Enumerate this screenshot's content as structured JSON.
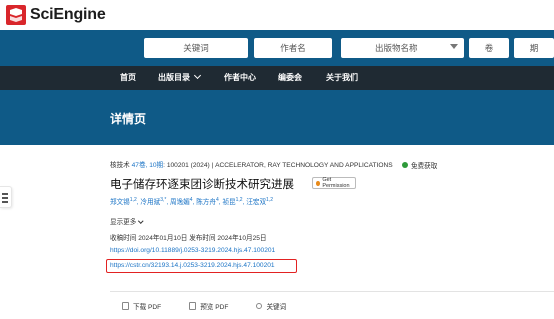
{
  "brand": {
    "name": "SciEngine"
  },
  "search": {
    "keyword": "关键词",
    "author": "作者名",
    "publication": "出版物名称",
    "volume": "卷",
    "issue": "期"
  },
  "nav": {
    "items": [
      {
        "label": "首页"
      },
      {
        "label": "出版目录"
      },
      {
        "label": "作者中心"
      },
      {
        "label": "编委会"
      },
      {
        "label": "关于我们"
      }
    ]
  },
  "banner": {
    "title": "详情页"
  },
  "article": {
    "meta_prefix": "核技术",
    "meta_volume": "47卷, 10期",
    "meta_rest": ": 100201 (2024) | ACCELERATOR, RAY TECHNOLOGY AND APPLICATIONS",
    "open_access": "免费获取",
    "title": "电子储存环逐束团诊断技术研究进展",
    "permission_button": "Get Permission",
    "authors": [
      {
        "name": "郑文锡",
        "sup": "1,2"
      },
      {
        "name": "冷用斌",
        "sup": "3,*"
      },
      {
        "name": "周逸媚",
        "sup": "4"
      },
      {
        "name": "陈方舟",
        "sup": "4"
      },
      {
        "name": "祯昆",
        "sup": "1,2"
      },
      {
        "name": "汪宏双",
        "sup": "1,2"
      }
    ],
    "show_more": "显示更多",
    "received_label": "收稿时间",
    "received_date": "2024年01月10日",
    "published_label": "发布时间",
    "published_date": "2024年10月25日",
    "doi": "https://doi.org/10.11889/j.0253-3219.2024.hjs.47.100201",
    "cstr": "https://cstr.cn/32193.14.j.0253-3219.2024.hjs.47.100201"
  },
  "toolbar": {
    "download_pdf": "下载 PDF",
    "preview_pdf": "预览 PDF",
    "keywords": "关键词"
  },
  "colors": {
    "primary": "#0f5a87",
    "nav_bg": "#1f2a33",
    "link": "#1a73c5",
    "highlight_box": "#e22222",
    "open_access_dot": "#2e9a3a"
  }
}
